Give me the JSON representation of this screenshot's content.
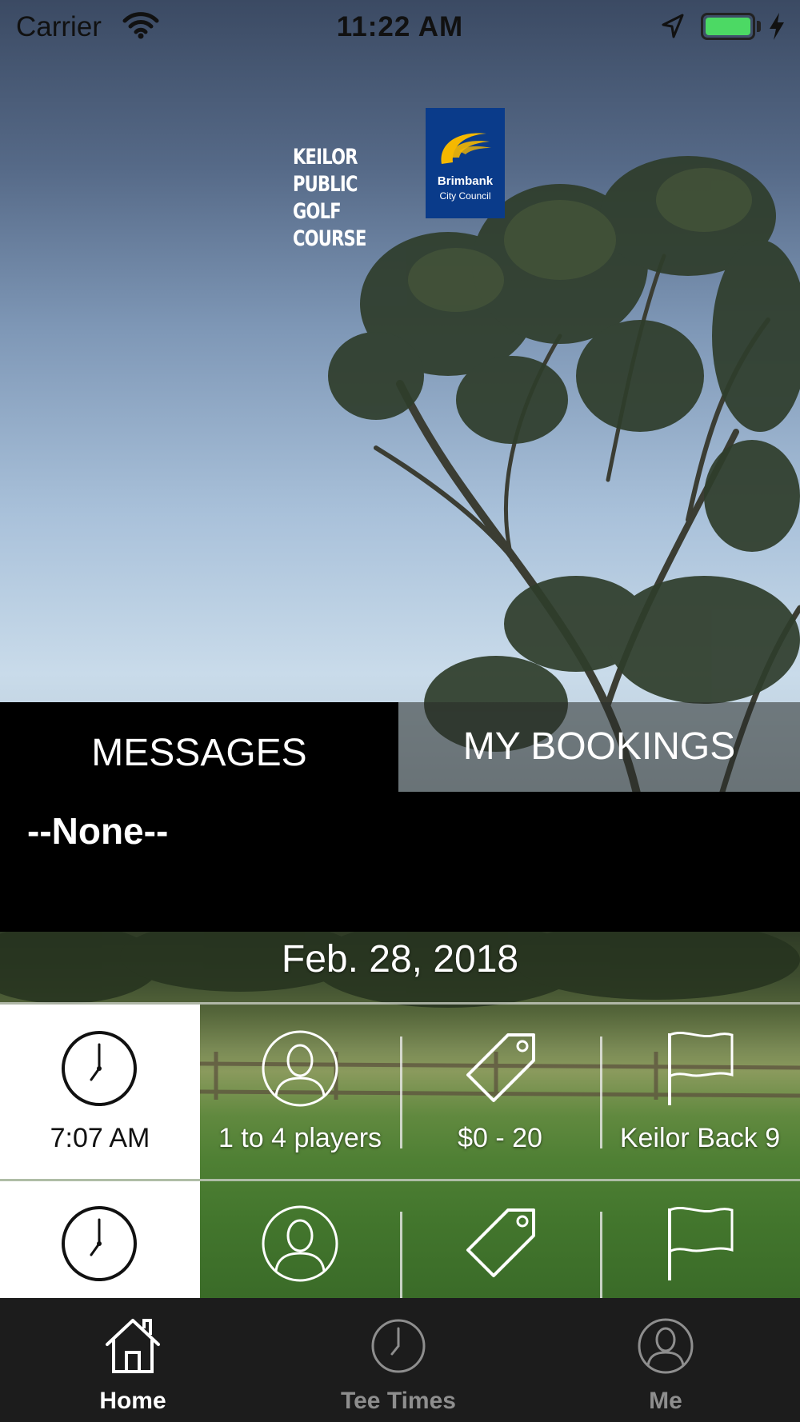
{
  "status_bar": {
    "carrier": "Carrier",
    "time": "11:22 AM",
    "battery_level": 1.0
  },
  "logo": {
    "line1": "KEILOR PUBLIC",
    "line2": "GOLF COURSE",
    "badge_name": "Brimbank",
    "badge_sub": "City Council",
    "badge_color": "#0a3b8a",
    "swoosh_color": "#f5b800"
  },
  "tabs": {
    "messages": "MESSAGES",
    "bookings": "MY BOOKINGS"
  },
  "messages": {
    "text": "--None--"
  },
  "date": "Feb. 28, 2018",
  "tee_times": [
    {
      "time": "7:07 AM",
      "players": "1 to 4 players",
      "price": "$0 - 20",
      "course": "Keilor Back 9"
    },
    {
      "time": "",
      "players": "",
      "price": "",
      "course": ""
    }
  ],
  "icons": {
    "time": "clock-icon",
    "players": "person-icon",
    "price": "price-tag-icon",
    "course": "flag-icon"
  },
  "tabbar": {
    "items": [
      {
        "label": "Home",
        "icon": "home-icon",
        "active": true
      },
      {
        "label": "Tee Times",
        "icon": "clock-icon",
        "active": false
      },
      {
        "label": "Me",
        "icon": "person-icon",
        "active": false
      }
    ],
    "active_color": "#ffffff",
    "inactive_color": "#8e8e8e"
  }
}
